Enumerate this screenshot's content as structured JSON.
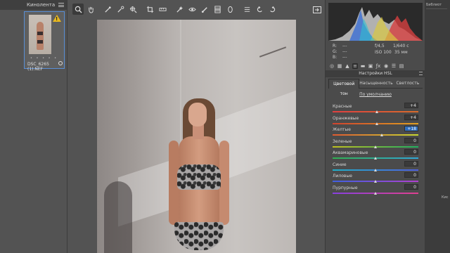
{
  "filmstrip": {
    "title": "Кинолента",
    "thumb": {
      "name": "DSC_6265 (1).NEF",
      "stars": "• • • • •",
      "warning": "!"
    }
  },
  "toolbar": {
    "tools": [
      "zoom-icon",
      "hand-icon",
      "white-balance-icon",
      "color-sampler-icon",
      "targeted-adjust-icon",
      "crop-icon",
      "straighten-icon",
      "spot-removal-icon",
      "red-eye-icon",
      "adjustment-brush-icon",
      "graduated-filter-icon",
      "radial-filter-icon",
      "presets-icon",
      "rotate-left-icon",
      "rotate-right-icon"
    ]
  },
  "panel": {
    "camera": {
      "r": "R:",
      "g": "G:",
      "b": "B:",
      "r_val": "---",
      "g_val": "---",
      "b_val": "---",
      "aperture": "f/4,5",
      "shutter": "1/640 с",
      "iso": "ISO 100",
      "focal": "35 мм"
    },
    "section_title": "Настройки HSL",
    "tabs": [
      "Цветовой тон",
      "Насыщенность",
      "Светлость"
    ],
    "default_link": "По умолчанию",
    "sliders": [
      {
        "label": "Красные",
        "value": "+4",
        "pos": 0.52,
        "colors": [
          "#e04040",
          "#d86b2c"
        ]
      },
      {
        "label": "Оранжевые",
        "value": "+4",
        "pos": 0.52,
        "colors": [
          "#d0432e",
          "#e0a020"
        ]
      },
      {
        "label": "Желтые",
        "value": "+18",
        "pos": 0.57,
        "colors": [
          "#e05a30",
          "#c8d830"
        ]
      },
      {
        "label": "Зеленые",
        "value": "0",
        "pos": 0.5,
        "colors": [
          "#c0c020",
          "#20b060"
        ]
      },
      {
        "label": "Аквамариновые",
        "value": "0",
        "pos": 0.5,
        "colors": [
          "#30b050",
          "#30a8d8"
        ]
      },
      {
        "label": "Синие",
        "value": "0",
        "pos": 0.5,
        "colors": [
          "#20b0c8",
          "#5060e0"
        ]
      },
      {
        "label": "Лиловые",
        "value": "0",
        "pos": 0.5,
        "colors": [
          "#4060e0",
          "#b040d0"
        ]
      },
      {
        "label": "Пурпурные",
        "value": "0",
        "pos": 0.5,
        "colors": [
          "#8840e0",
          "#e04090"
        ]
      }
    ]
  },
  "sidebar_right": {
    "tab1": "Библиот",
    "tab2": "Кис"
  }
}
